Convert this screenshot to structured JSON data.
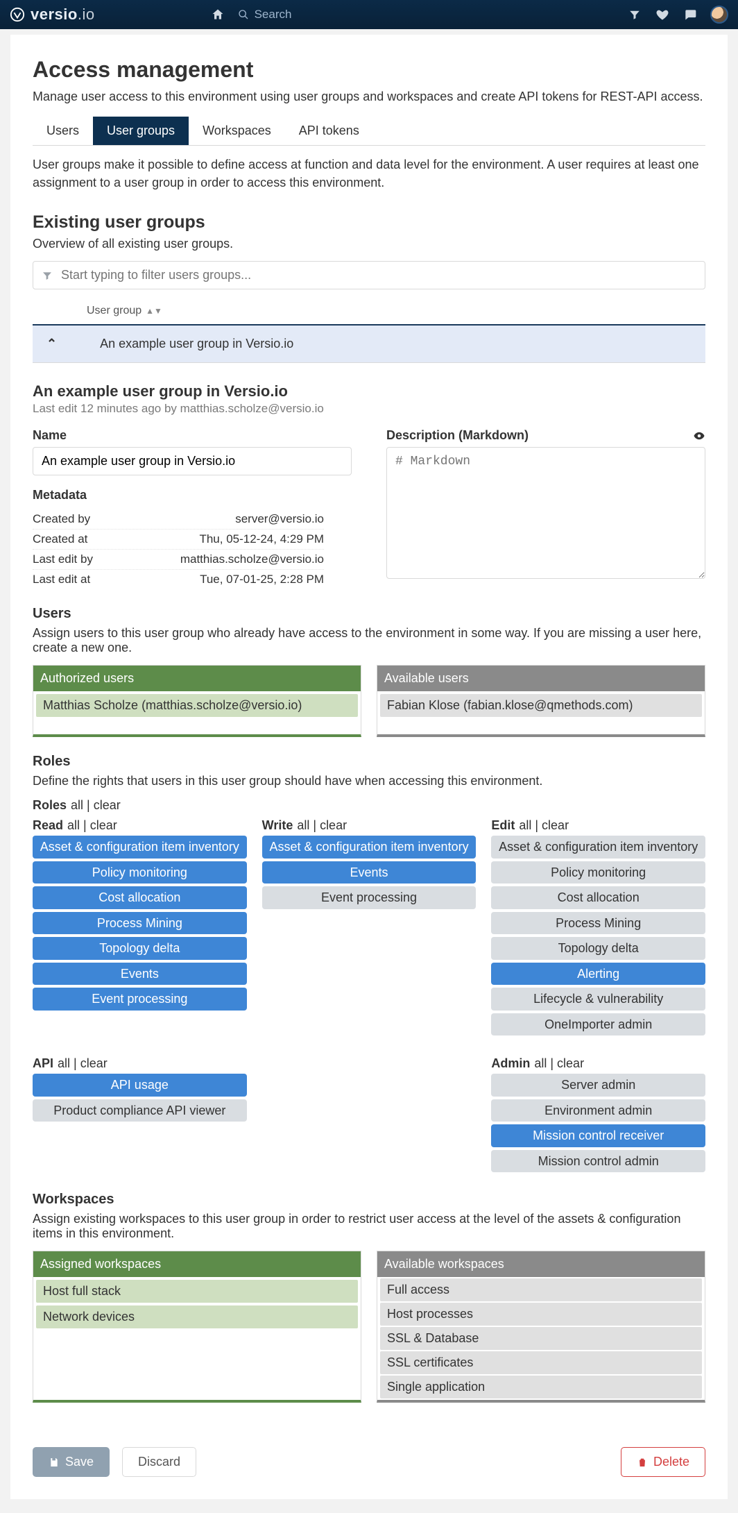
{
  "brand": {
    "name": "versio",
    "suffix": ".io"
  },
  "topbar": {
    "search_placeholder": "Search"
  },
  "page": {
    "title": "Access management",
    "lead": "Manage user access to this environment using user groups and workspaces and create API tokens for REST-API access."
  },
  "tabs": [
    {
      "id": "users",
      "label": "Users",
      "active": false
    },
    {
      "id": "user-groups",
      "label": "User groups",
      "active": true
    },
    {
      "id": "workspaces",
      "label": "Workspaces",
      "active": false
    },
    {
      "id": "api-tokens",
      "label": "API tokens",
      "active": false
    }
  ],
  "tab_desc": "User groups make it possible to define access at function and data level for the environment. A user requires at least one assignment to a user group in order to access this environment.",
  "existing": {
    "title": "Existing user groups",
    "sub": "Overview of all existing user groups.",
    "filter_placeholder": "Start typing to filter users groups...",
    "col_header": "User group",
    "expanded_group": "An example user group in Versio.io"
  },
  "detail": {
    "title": "An example user group in Versio.io",
    "last_edit": "Last edit 12 minutes ago by matthias.scholze@versio.io",
    "name_label": "Name",
    "name_value": "An example user group in Versio.io",
    "desc_label": "Description (Markdown)",
    "desc_placeholder": "# Markdown",
    "metadata_label": "Metadata",
    "metadata": [
      {
        "k": "Created by",
        "v": "server@versio.io"
      },
      {
        "k": "Created at",
        "v": "Thu, 05-12-24, 4:29 PM"
      },
      {
        "k": "Last edit by",
        "v": "matthias.scholze@versio.io"
      },
      {
        "k": "Last edit at",
        "v": "Tue, 07-01-25, 2:28 PM"
      }
    ]
  },
  "users": {
    "heading": "Users",
    "desc": "Assign users to this user group who already have access to the environment in some way. If you are missing a user here, create a new one.",
    "authorized_title": "Authorized users",
    "authorized": [
      "Matthias Scholze (matthias.scholze@versio.io)"
    ],
    "available_title": "Available users",
    "available": [
      "Fabian Klose (fabian.klose@qmethods.com)"
    ]
  },
  "roles": {
    "heading": "Roles",
    "desc": "Define the rights that users in this user group should have when accessing this environment.",
    "all_label": "all",
    "clear_label": "clear",
    "groups": [
      {
        "name": "Roles",
        "items": []
      },
      {
        "name": "Read",
        "items": [
          {
            "label": "Asset & configuration item inventory",
            "on": true
          },
          {
            "label": "Policy monitoring",
            "on": true
          },
          {
            "label": "Cost allocation",
            "on": true
          },
          {
            "label": "Process Mining",
            "on": true
          },
          {
            "label": "Topology delta",
            "on": true
          },
          {
            "label": "Events",
            "on": true
          },
          {
            "label": "Event processing",
            "on": true
          }
        ]
      },
      {
        "name": "Write",
        "items": [
          {
            "label": "Asset & configuration item inventory",
            "on": true
          },
          {
            "label": "Events",
            "on": true
          },
          {
            "label": "Event processing",
            "on": false
          }
        ]
      },
      {
        "name": "Edit",
        "items": [
          {
            "label": "Asset & configuration item inventory",
            "on": false
          },
          {
            "label": "Policy monitoring",
            "on": false
          },
          {
            "label": "Cost allocation",
            "on": false
          },
          {
            "label": "Process Mining",
            "on": false
          },
          {
            "label": "Topology delta",
            "on": false
          },
          {
            "label": "Alerting",
            "on": true
          },
          {
            "label": "Lifecycle & vulnerability",
            "on": false
          },
          {
            "label": "OneImporter admin",
            "on": false
          }
        ]
      },
      {
        "name": "API",
        "items": [
          {
            "label": "API usage",
            "on": true
          },
          {
            "label": "Product compliance API viewer",
            "on": false
          }
        ]
      },
      {
        "name": "Admin",
        "items": [
          {
            "label": "Server admin",
            "on": false
          },
          {
            "label": "Environment admin",
            "on": false
          },
          {
            "label": "Mission control receiver",
            "on": true
          },
          {
            "label": "Mission control admin",
            "on": false
          }
        ]
      }
    ]
  },
  "workspaces": {
    "heading": "Workspaces",
    "desc": "Assign existing workspaces to this user group in order to restrict user access at the level of the assets & configuration items in this environment.",
    "assigned_title": "Assigned workspaces",
    "assigned": [
      "Host full stack",
      "Network devices"
    ],
    "available_title": "Available workspaces",
    "available": [
      "Full access",
      "Host processes",
      "SSL & Database",
      "SSL certificates",
      "Single application"
    ]
  },
  "footer": {
    "save": "Save",
    "discard": "Discard",
    "delete": "Delete"
  }
}
